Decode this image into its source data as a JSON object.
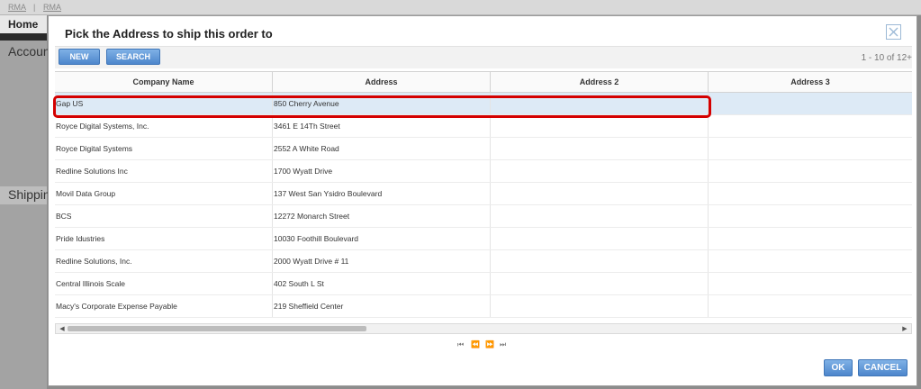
{
  "background": {
    "tabs": [
      "RMA",
      "RMA"
    ],
    "home_label": "Home",
    "account_label": "Accoun",
    "shipping_label": "Shippin"
  },
  "dialog": {
    "title": "Pick the Address to ship this order to",
    "close_icon": "close-x-icon",
    "toolbar": {
      "new_label": "NEW",
      "search_label": "SEARCH"
    },
    "pager_count": "1 - 10 of 12+",
    "columns": [
      "Company Name",
      "Address",
      "Address 2",
      "Address 3"
    ],
    "rows": [
      [
        "Gap US",
        "850 Cherry Avenue",
        "",
        ""
      ],
      [
        "Royce Digital Systems, Inc.",
        "3461 E 14Th Street",
        "",
        ""
      ],
      [
        "Royce Digital Systems",
        "2552 A White Road",
        "",
        ""
      ],
      [
        "Redline Solutions Inc",
        "1700 Wyatt Drive",
        "",
        ""
      ],
      [
        "Movil Data Group",
        "137 West San Ysidro Boulevard",
        "",
        ""
      ],
      [
        "BCS",
        "12272 Monarch Street",
        "",
        ""
      ],
      [
        "Pride Idustries",
        "10030 Foothill Boulevard",
        "",
        ""
      ],
      [
        "Redline Solutions, Inc.",
        "2000 Wyatt Drive # 11",
        "",
        ""
      ],
      [
        "Central Illinois Scale",
        "402 South L St",
        "",
        ""
      ],
      [
        "Macy's Corporate Expense Payable",
        "219 Sheffield Center",
        "",
        ""
      ]
    ],
    "selected_row": 0,
    "pager_nav": [
      "first-page-icon",
      "prev-page-icon",
      "next-page-icon",
      "last-page-icon"
    ],
    "buttons": {
      "ok": "OK",
      "cancel": "CANCEL"
    },
    "colors": {
      "button_blue": "#5b93d6",
      "selected_row": "#ddeaf6",
      "highlight_red": "#d40000"
    }
  }
}
